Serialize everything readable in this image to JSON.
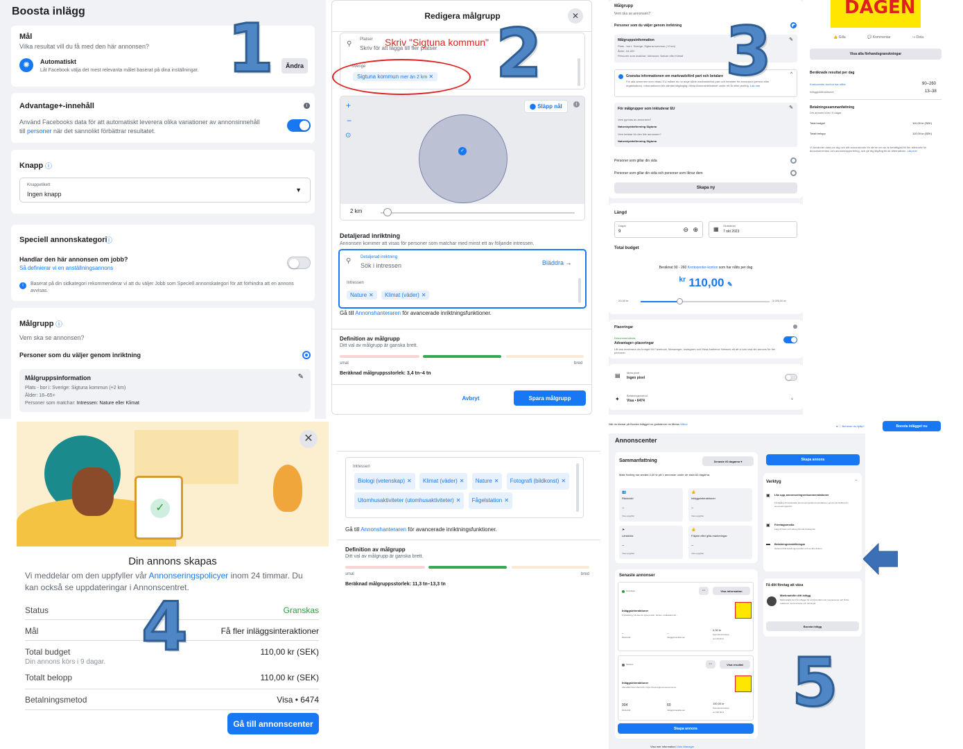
{
  "p1": {
    "header_title": "Boosta inlägg",
    "goal": {
      "title": "Mål",
      "question": "Vilka resultat vill du få med den här annonsen?",
      "option_title": "Automatiskt",
      "option_desc": "Låt Facebook välja det mest relevanta målet baserat på dina inställningar.",
      "change_label": "Ändra"
    },
    "advantage": {
      "title": "Advantage+-innehåll",
      "desc_a": "Använd Facebooks data för att automatiskt leverera olika variationer av annonsinnehåll",
      "desc_b_pre": "till ",
      "desc_b_link": "personer",
      "desc_b_post": " när det sannolikt förbättrar resultatet."
    },
    "button": {
      "title": "Knapp",
      "field_label": "Knappetikett",
      "field_value": "Ingen knapp"
    },
    "special": {
      "title": "Speciell annonskategori",
      "question": "Handlar den här annonsen om jobb?",
      "link": "Så definierar vi en anställningsannons",
      "info": "Baserat på din sidkategori rekommenderar vi att du väljer Jobb som Speciell annonskategori för att förhindra att en annons avvisas."
    },
    "audience": {
      "title": "Målgrupp",
      "question": "Vem ska se annonsen?",
      "option": "Personer som du väljer genom inriktning",
      "info_title": "Målgruppsinformation",
      "info_place": "Plats - bor i: Sverige: Sigtuna kommun (+2 km)",
      "info_age": "Ålder: 18–65+",
      "info_match_pre": "Personer som matchar: ",
      "info_match_val": "Intressen: Nature eller Klimat"
    }
  },
  "p2": {
    "title": "Redigera målgrupp",
    "places_label": "Platser",
    "places_placeholder": "Skriv för att lägga till fler platser",
    "annotation": "Skriv \"Sigtuna kommun\"",
    "country": "Sverige",
    "location_chip": "Sigtuna kommun",
    "location_chip_extra": "mer än 2 km",
    "drop_pin": "Släpp nål",
    "radius": "2 km",
    "detailed_title": "Detaljerad inriktning",
    "detailed_desc": "Annonsen kommer att visas för personer som matchar med minst ett av följande intressen.",
    "search_label": "Detaljerad inriktning",
    "search_placeholder": "Sök i intressen",
    "browse": "Bläddra",
    "interests_label": "Intressen",
    "interests": [
      "Nature",
      "Klimat (väder)"
    ],
    "adsmanager_pre": "Gå till ",
    "adsmanager_link": "Annonshanteraren",
    "adsmanager_post": " för avancerade inriktningsfunktioner.",
    "definition_title": "Definition av målgrupp",
    "definition_desc": "Ditt val av målgrupp är ganska brett.",
    "narrow": "smal",
    "broad": "bred",
    "size": "Beräknad målgruppsstorlek: 3,4 tn–4 tn",
    "cancel": "Avbryt",
    "save": "Spara målgrupp"
  },
  "p3": {
    "audience_title": "Målgrupp",
    "audience_question": "Vem ska se annonsen?",
    "audience_option": "Personer som du väljer genom inriktning",
    "info_title": "Målgruppsinformation",
    "info_line1": "Plats - bor i: Sverige: Sigtuna kommun (+2 km)",
    "info_line2": "Ålder: 18–65+",
    "info_line3": "Personer som matchar: Intressen: Nature eller Klimat",
    "review_title": "Granska informationen om marknadsförd part och betalare",
    "review_desc": "För alla annonser som visas i EU måste du nu ange både marknadsförd part och betalare för annonsen (person eller organisation). Informationen blir allmänt tillgänglig i Meta Annonsbiblioteket under ett år efter visning.",
    "review_link": "Läs mer",
    "eu_title": "För målgrupper som inkluderar EU",
    "eu_q1": "Vem gynnas av annonsen?",
    "eu_a1": "Naturskyddsförening Sigtuna",
    "eu_q2": "Vem betalar för den här annonsen?",
    "eu_a2": "Naturskyddsförening Sigtuna",
    "opt_like": "Personer som gillar din sida",
    "opt_like_similar": "Personer som gillar din sida och personer som liknar dem",
    "create_new": "Skapa ny",
    "length_title": "Längd",
    "days_label": "Dagar",
    "days_value": "9",
    "end_label": "Slutdatum",
    "end_value": "7 okt 2023",
    "budget_title": "Total budget",
    "estimate_pre": "Beräknat 90 - 260 ",
    "estimate_link": "Kontocenter-konton",
    "estimate_post": " som har nåtts per dag",
    "currency": "kr",
    "budget": "110,00",
    "slider_min": "20,00 kr",
    "slider_max": "3 000,00 kr",
    "budget_level": 0.3,
    "placements_title": "Placeringar",
    "recommended": "Rekommenderas",
    "advantage_placements": "Advantage+-placeringar",
    "placements_desc": "Låt oss maximera din budget för Facebook, Messenger, Instagram och Meta Audience Network så att vi kan visa din annons för fler personer.",
    "pixel_label": "Meta pixel",
    "pixel_value": "Ingen pixel",
    "payment_label": "Betalningsmetod",
    "payment_value": "Visa • 6474",
    "dagen": "DAGEN",
    "like": "Gilla",
    "comment": "Kommentar",
    "share": "Dela",
    "preview_all": "Visa alla förhandsgranskningar",
    "results_title": "Beräknade resultat per dag",
    "reach_label": "Kontocenter-konton har nåtts",
    "reach_value": "90–260",
    "interactions_label": "Inläggsinteraktioner",
    "interactions_value": "13–38",
    "pay_title": "Betalningssammanfattning",
    "pay_desc": "Din annons körs i 9 dagar.",
    "total_budget": "Total budget",
    "total_budget_val": "110,00 kr (SEK)",
    "total_amount": "Totalt belopp",
    "total_amount_val": "110,00 kr (SEK)",
    "disclaimer": "Vi använder data om dig och ditt annonskonto för att se om du är berättigad till fler alternativ för annonsleverans och annonsrapportering, och ge dig tillgång till de alternativen.",
    "disclaimer_link": "Läs mer"
  },
  "p4": {
    "title": "Din annons skapas",
    "desc_pre": "Vi meddelar om den uppfyller vår ",
    "desc_link": "Annonseringspolicyer",
    "desc_post": " inom 24 timmar. Du kan också se uppdateringar i Annonscentret.",
    "rows": [
      {
        "label": "Status",
        "value": "Granskas",
        "sub": ""
      },
      {
        "label": "Mål",
        "value": "Få fler inläggsinteraktioner",
        "sub": ""
      },
      {
        "label": "Total budget",
        "value": "110,00 kr (SEK)",
        "sub": "Din annons körs i 9 dagar."
      },
      {
        "label": "Totalt belopp",
        "value": "110,00 kr (SEK)",
        "sub": ""
      },
      {
        "label": "Betalningsmetod",
        "value": "Visa • 6474",
        "sub": ""
      }
    ],
    "button": "Gå till annonscenter",
    "status_color": "#2a9d3a"
  },
  "p6": {
    "interests_label": "Intressen",
    "interests": [
      "Biologi (vetenskap)",
      "Klimat (väder)",
      "Nature",
      "Fotografi (bildkonst)",
      "Utomhusaktiviteter (utomhusaktiviteter)",
      "Fågelstation"
    ],
    "adsmanager_pre": "Gå till ",
    "adsmanager_link": "Annonshanteraren",
    "adsmanager_post": " för avancerade inriktningsfunktioner.",
    "definition_title": "Definition av målgrupp",
    "definition_desc": "Ditt val av målgrupp är ganska brett.",
    "narrow": "smal",
    "broad": "bred",
    "size": "Beräknad målgruppsstorlek: 11,3 tn–13,3 tn"
  },
  "p5": {
    "top_note_pre": "När du klickar på Boosta inlägget nu godkänner du Metas ",
    "top_note_link": "Villkor",
    "help": "Behöver du hjälp?",
    "boost_now": "Boosta inlägget nu",
    "title": "Annonscenter",
    "summary_title": "Sammanfattning",
    "period": "Senaste 60 dagarna",
    "summary_desc": "Matz Norling har använt 0,00 kr på 1 annonser under de sista 60 dagarna.",
    "metrics": [
      {
        "label": "Räckvidd",
        "value": "--",
        "link": "Visa uppgifter"
      },
      {
        "label": "Inläggsinteraktioner",
        "value": "--",
        "link": "Visa uppgifter"
      },
      {
        "label": "Länkklick",
        "value": "--",
        "link": "Visa uppgifter"
      },
      {
        "label": "Följare eller gilla-markeringar",
        "value": "--",
        "link": "Visa uppgifter"
      }
    ],
    "recent_title": "Senaste annonser",
    "ad1": {
      "status": "Granskas",
      "info_btn": "Visa information",
      "type": "Inläggsinteraktioner",
      "desc": "Fryksdaring: Nu kan du byta porslin, böcker, småelektronik...",
      "reach": "--",
      "reach_label": "Räckvidd",
      "inter": "--",
      "inter_label": "Inläggsinteraktioner",
      "spent": "0,00 kr",
      "spent_label": "Spenderat belopp",
      "spent_sub": "av 110,00 kr"
    },
    "ad2": {
      "status": "Slutförd",
      "info_btn": "Visa resultat",
      "type": "Inläggsinteraktioner",
      "desc": "Alla välkomna! Mera info: https://www.sigtuna.se/evenema...",
      "reach": "904",
      "reach_label": "Räckvidd",
      "inter": "60",
      "inter_label": "Inläggsinteraktioner",
      "spent": "150,00 kr",
      "spent_label": "Spenderat belopp",
      "spent_sub": "av 150,00 kr"
    },
    "create_ad": "Skapa annons",
    "more_pre": "Visa mer information i ",
    "more_link": "Ads Manager",
    "tools_title": "Verktyg",
    "tool1_title": "Lås upp annonseringsrekommendationer",
    "tool1_desc": "Få tillgång till anpassade annonseringsrekommendationer genom att slutföra din annonseringsprofil.",
    "tool2_title": "Företagsmedia",
    "tool2_desc": "Lägg till foton och videor från ditt företag här.",
    "tool3_title": "Betalningsinställningar",
    "tool3_desc": "Hantera dina betalningsmetoder och se dina kvitton.",
    "grow_title": "Få ditt företag att växa",
    "grow_item_title": "Marknadsför ditt inlägg",
    "grow_item_desc": "Marknadsför det här inlägget för att få kontakt med nya personer och få fler reaktioner, kommentarer och delningar.",
    "boost_post": "Boosta inlägg"
  },
  "numbers": [
    "1",
    "2",
    "3",
    "4",
    "5"
  ],
  "colors": {
    "accent": "#1877f2",
    "annotation_red": "#e02020",
    "number_blue": "#4f86c6",
    "arrow_blue": "#3b6fb6"
  }
}
